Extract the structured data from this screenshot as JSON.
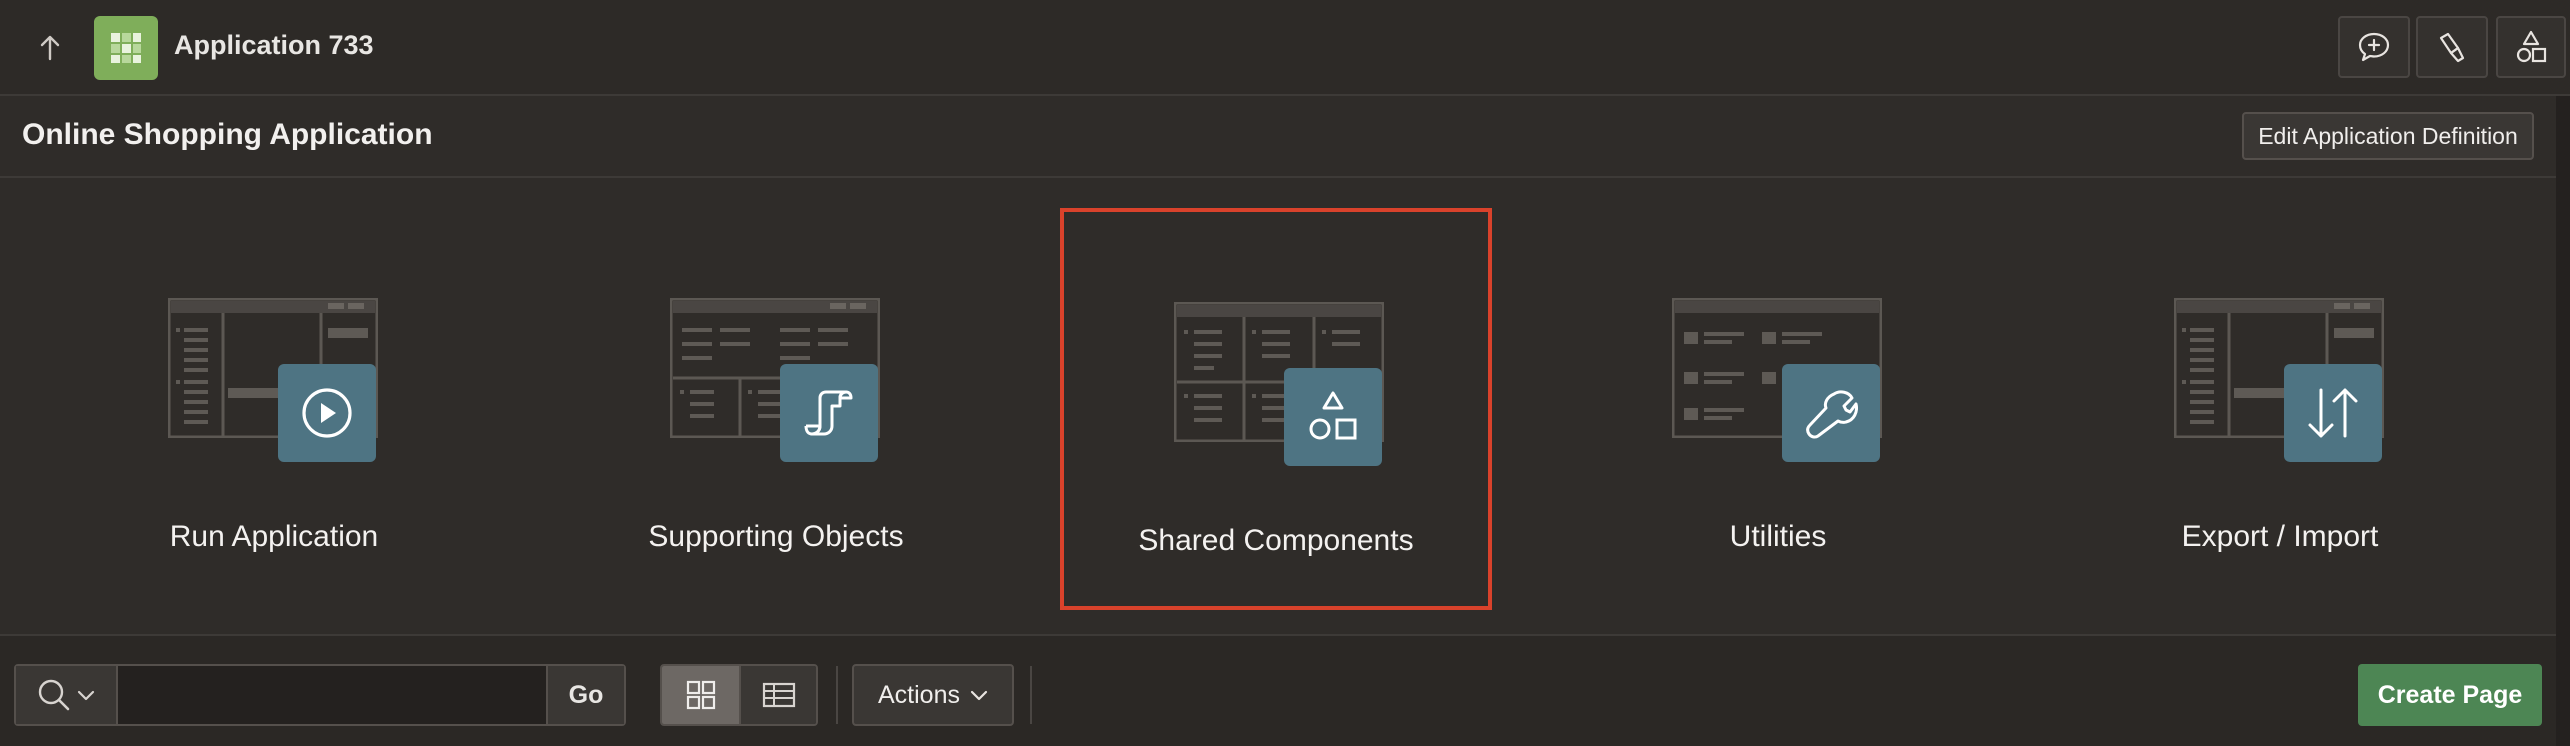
{
  "header": {
    "app_title": "Application 733",
    "up_icon": "arrow-up-icon",
    "logo_icon": "app-grid-icon",
    "tools": [
      {
        "icon": "comment-add-icon"
      },
      {
        "icon": "flashlight-icon"
      },
      {
        "icon": "shapes-icon"
      }
    ]
  },
  "subheader": {
    "title": "Online Shopping Application",
    "edit_button_label": "Edit Application Definition"
  },
  "cards": [
    {
      "label": "Run Application",
      "icon": "play-icon",
      "selected": false
    },
    {
      "label": "Supporting Objects",
      "icon": "scroll-icon",
      "selected": false
    },
    {
      "label": "Shared Components",
      "icon": "shapes-icon",
      "selected": true
    },
    {
      "label": "Utilities",
      "icon": "wrench-icon",
      "selected": false
    },
    {
      "label": "Export / Import",
      "icon": "arrows-up-down-icon",
      "selected": false
    }
  ],
  "toolbar": {
    "search_placeholder": "",
    "search_value": "",
    "go_label": "Go",
    "view_modes": [
      {
        "icon": "icon-view-icon",
        "active": true
      },
      {
        "icon": "report-view-icon",
        "active": false
      }
    ],
    "actions_label": "Actions",
    "create_page_label": "Create Page"
  },
  "colors": {
    "background": "#2f2c29",
    "badge": "#4e7483",
    "selection_border": "#d9422b",
    "primary_button": "#4d8654",
    "logo": "#7fae5a"
  }
}
